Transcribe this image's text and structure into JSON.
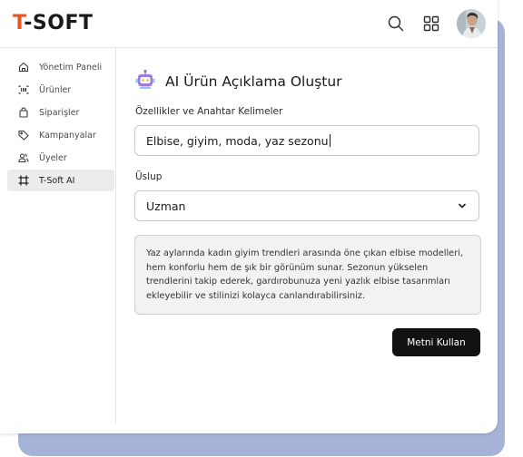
{
  "brand": {
    "logo_prefix": "T",
    "logo_rest": "-SOFT",
    "accent_color": "#e8542a"
  },
  "header": {
    "icons": [
      "search-icon",
      "grid-icon",
      "avatar"
    ]
  },
  "sidebar": {
    "items": [
      {
        "label": "Yönetim Paneli",
        "icon": "home-icon"
      },
      {
        "label": "Ürünler",
        "icon": "barcode-icon"
      },
      {
        "label": "Siparişler",
        "icon": "bag-icon"
      },
      {
        "label": "Kampanyalar",
        "icon": "tag-icon"
      },
      {
        "label": "Üyeler",
        "icon": "users-icon"
      },
      {
        "label": "T-Soft AI",
        "icon": "frame-icon",
        "active": true
      }
    ]
  },
  "main": {
    "title": "AI Ürün Açıklama Oluştur",
    "keywords_label": "Özellikler ve Anahtar Kelimeler",
    "keywords_value": "Elbise, giyim, moda, yaz sezonu",
    "style_label": "Üslup",
    "style_value": "Uzman",
    "generated_text": "Yaz aylarında kadın giyim trendleri arasında öne çıkan elbise modelleri, hem konforlu hem de şık bir görünüm sunar. Sezonun yükselen trendlerini takip ederek, gardırobunuza yeni yazlık elbise tasarımları ekleyebilir ve stilinizi kolayca canlandırabilirsiniz.",
    "use_button": "Metni Kullan"
  }
}
